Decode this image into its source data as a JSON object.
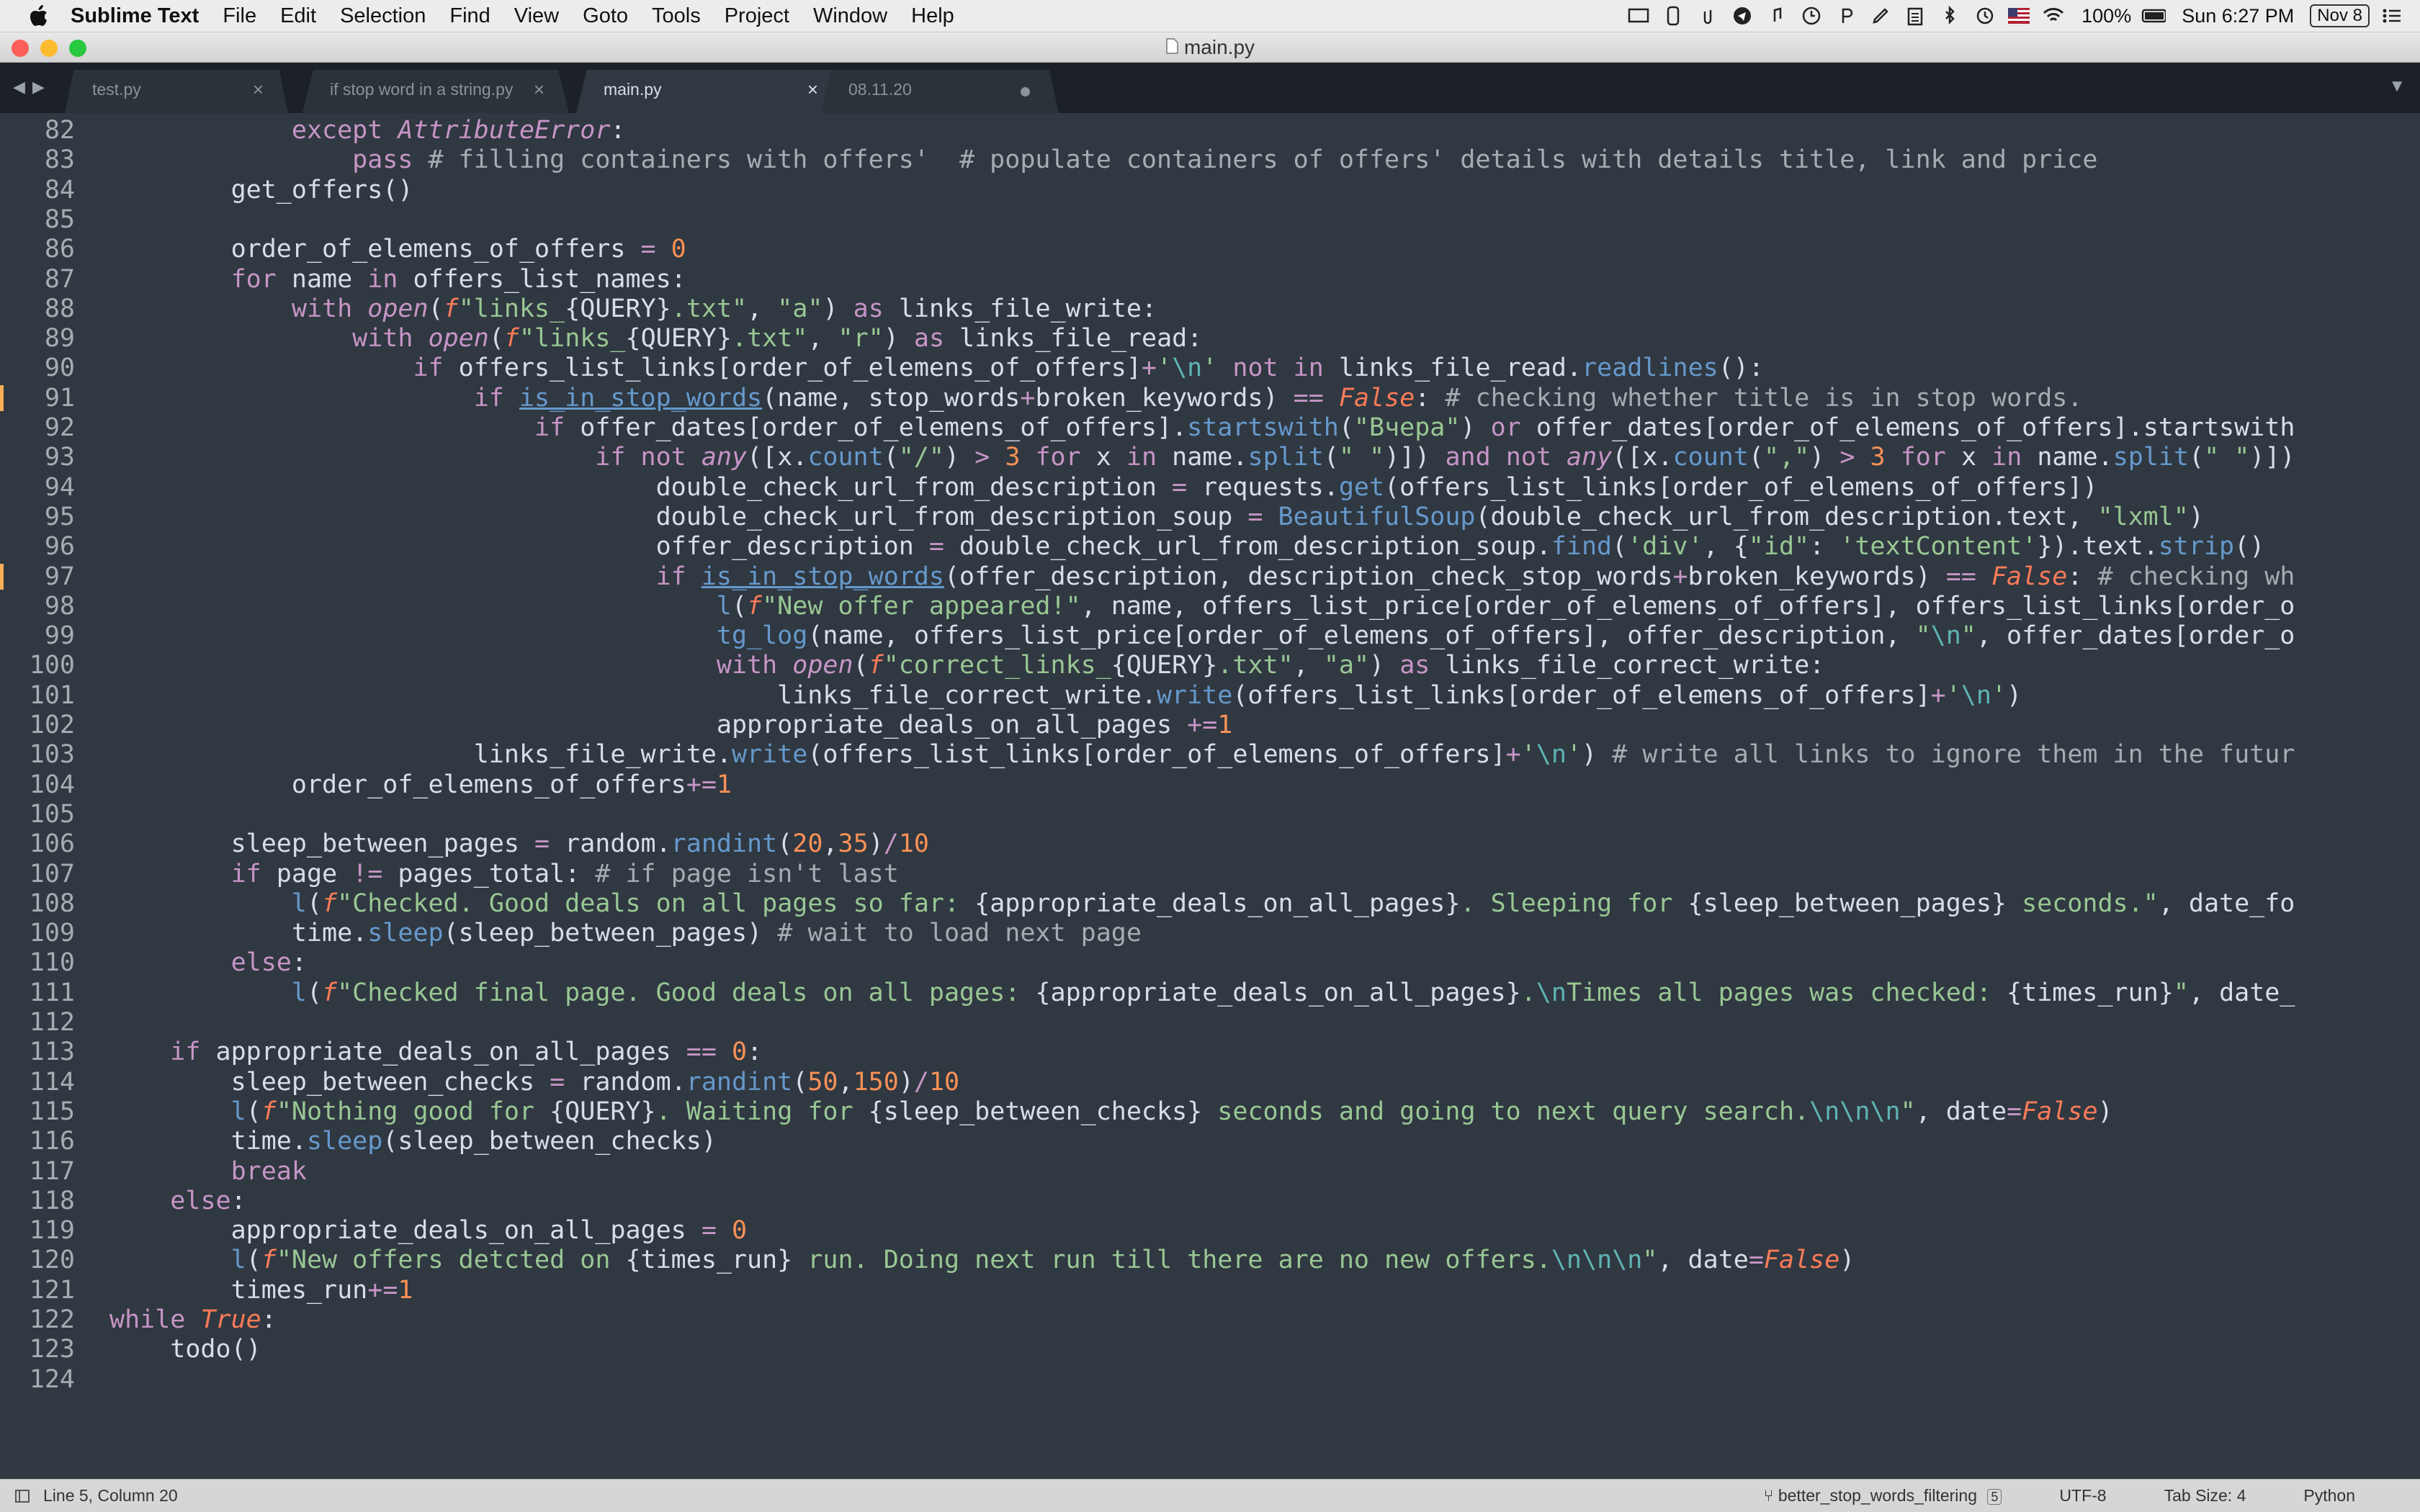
{
  "menubar": {
    "app_name": "Sublime Text",
    "items": [
      "File",
      "Edit",
      "Selection",
      "Find",
      "View",
      "Goto",
      "Tools",
      "Project",
      "Window",
      "Help"
    ],
    "battery": "100%",
    "clock": "Sun 6:27 PM",
    "date_badge": "Nov 8"
  },
  "window": {
    "title": "main.py"
  },
  "tabs": [
    {
      "label": "test.py",
      "state": "close"
    },
    {
      "label": "if stop word in a string.py",
      "state": "close"
    },
    {
      "label": "main.py",
      "state": "close",
      "active": true
    },
    {
      "label": "08.11.20",
      "state": "dirty"
    }
  ],
  "status": {
    "position": "Line 5, Column 20",
    "branch": "better_stop_words_filtering",
    "branch_count": "5",
    "encoding": "UTF-8",
    "tab_size": "Tab Size: 4",
    "syntax": "Python"
  },
  "editor": {
    "lines": [
      {
        "num": "82",
        "code": "            except AttributeError:"
      },
      {
        "num": "83",
        "code": "                pass # filling containers with offers'  # populate containers of offers' details with details title, link and price"
      },
      {
        "num": "84",
        "code": "        get_offers()"
      },
      {
        "num": "85",
        "code": ""
      },
      {
        "num": "86",
        "code": "        order_of_elemens_of_offers = 0"
      },
      {
        "num": "87",
        "code": "        for name in offers_list_names:"
      },
      {
        "num": "88",
        "code": "            with open(f\"links_{QUERY}.txt\", \"a\") as links_file_write:"
      },
      {
        "num": "89",
        "code": "                with open(f\"links_{QUERY}.txt\", \"r\") as links_file_read:"
      },
      {
        "num": "90",
        "code": "                    if offers_list_links[order_of_elemens_of_offers]+'\\n' not in links_file_read.readlines():"
      },
      {
        "num": "91",
        "code": "                        if is_in_stop_words(name, stop_words+broken_keywords) == False: # checking whether title is in stop words."
      },
      {
        "num": "92",
        "code": "                            if offer_dates[order_of_elemens_of_offers].startswith(\"Вчера\") or offer_dates[order_of_elemens_of_offers].startswith"
      },
      {
        "num": "93",
        "code": "                                if not any([x.count(\"/\") > 3 for x in name.split(\" \")]) and not any([x.count(\",\") > 3 for x in name.split(\" \")])"
      },
      {
        "num": "94",
        "code": "                                    double_check_url_from_description = requests.get(offers_list_links[order_of_elemens_of_offers])"
      },
      {
        "num": "95",
        "code": "                                    double_check_url_from_description_soup = BeautifulSoup(double_check_url_from_description.text, \"lxml\")"
      },
      {
        "num": "96",
        "code": "                                    offer_description = double_check_url_from_description_soup.find('div', {\"id\": 'textContent'}).text.strip()"
      },
      {
        "num": "97",
        "code": "                                    if is_in_stop_words(offer_description, description_check_stop_words+broken_keywords) == False: # checking wh"
      },
      {
        "num": "98",
        "code": "                                        l(f\"New offer appeared!\", name, offers_list_price[order_of_elemens_of_offers], offers_list_links[order_o"
      },
      {
        "num": "99",
        "code": "                                        tg_log(name, offers_list_price[order_of_elemens_of_offers], offer_description, \"\\n\", offer_dates[order_o"
      },
      {
        "num": "100",
        "code": "                                        with open(f\"correct_links_{QUERY}.txt\", \"a\") as links_file_correct_write:"
      },
      {
        "num": "101",
        "code": "                                            links_file_correct_write.write(offers_list_links[order_of_elemens_of_offers]+'\\n')"
      },
      {
        "num": "102",
        "code": "                                        appropriate_deals_on_all_pages +=1"
      },
      {
        "num": "103",
        "code": "                        links_file_write.write(offers_list_links[order_of_elemens_of_offers]+'\\n') # write all links to ignore them in the futur"
      },
      {
        "num": "104",
        "code": "            order_of_elemens_of_offers+=1"
      },
      {
        "num": "105",
        "code": ""
      },
      {
        "num": "106",
        "code": "        sleep_between_pages = random.randint(20,35)/10"
      },
      {
        "num": "107",
        "code": "        if page != pages_total: # if page isn't last"
      },
      {
        "num": "108",
        "code": "            l(f\"Checked. Good deals on all pages so far: {appropriate_deals_on_all_pages}. Sleeping for {sleep_between_pages} seconds.\", date_fo"
      },
      {
        "num": "109",
        "code": "            time.sleep(sleep_between_pages) # wait to load next page"
      },
      {
        "num": "110",
        "code": "        else:"
      },
      {
        "num": "111",
        "code": "            l(f\"Checked final page. Good deals on all pages: {appropriate_deals_on_all_pages}.\\nTimes all pages was checked: {times_run}\", date_"
      },
      {
        "num": "112",
        "code": ""
      },
      {
        "num": "113",
        "code": "    if appropriate_deals_on_all_pages == 0:"
      },
      {
        "num": "114",
        "code": "        sleep_between_checks = random.randint(50,150)/10"
      },
      {
        "num": "115",
        "code": "        l(f\"Nothing good for {QUERY}. Waiting for {sleep_between_checks} seconds and going to next query search.\\n\\n\\n\", date=False)"
      },
      {
        "num": "116",
        "code": "        time.sleep(sleep_between_checks)"
      },
      {
        "num": "117",
        "code": "        break"
      },
      {
        "num": "118",
        "code": "    else:"
      },
      {
        "num": "119",
        "code": "        appropriate_deals_on_all_pages = 0"
      },
      {
        "num": "120",
        "code": "        l(f\"New offers detcted on {times_run} run. Doing next run till there are no new offers.\\n\\n\\n\", date=False)"
      },
      {
        "num": "121",
        "code": "        times_run+=1"
      },
      {
        "num": "122",
        "code": "while True:"
      },
      {
        "num": "123",
        "code": "    todo()"
      },
      {
        "num": "124",
        "code": ""
      }
    ],
    "modified_lines": [
      "91",
      "97"
    ]
  },
  "colors": {
    "editor_bg": "#303841",
    "keyword": "#c695c6",
    "function": "#6699cc",
    "string": "#99c794",
    "number": "#f99157",
    "comment": "#a6acb3",
    "modified_marker": "#f9ae58"
  }
}
